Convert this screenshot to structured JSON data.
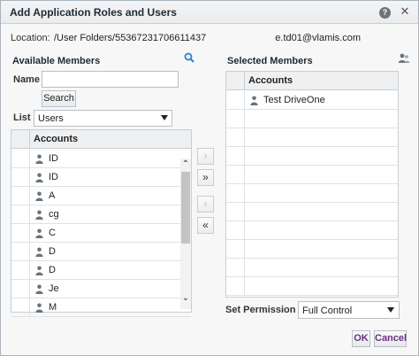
{
  "dialog": {
    "title": "Add Application Roles and Users",
    "help_label": "?",
    "close_label": "✕"
  },
  "location": {
    "label": "Location:",
    "path": "/User Folders/55367231706611437",
    "suffix": "e.td01@vlamis.com"
  },
  "available": {
    "title": "Available Members",
    "name_label": "Name",
    "name_value": "",
    "search_label": "Search",
    "list_label": "List",
    "list_value": "Users",
    "header": "Accounts",
    "rows": [
      "ID",
      "ID",
      "A",
      "cg",
      "C",
      "D",
      "D",
      "Je",
      "M"
    ]
  },
  "selected": {
    "title": "Selected Members",
    "header": "Accounts",
    "rows": [
      "Test DriveOne"
    ]
  },
  "move_buttons": {
    "move_one": "›",
    "move_all": "»",
    "remove_one": "‹",
    "remove_all": "«"
  },
  "permission": {
    "label": "Set Permission to",
    "value": "Full Control"
  },
  "footer": {
    "ok_label": "OK",
    "cancel_label": "Cancel"
  },
  "colors": {
    "accent_text": "#6b2f82",
    "search_icon": "#2f7fc1"
  },
  "icons": [
    "help-icon",
    "close-icon",
    "search-icon",
    "people-icon",
    "user-icon",
    "scroll-up-icon",
    "scroll-down-icon",
    "chevron-down-icon"
  ]
}
